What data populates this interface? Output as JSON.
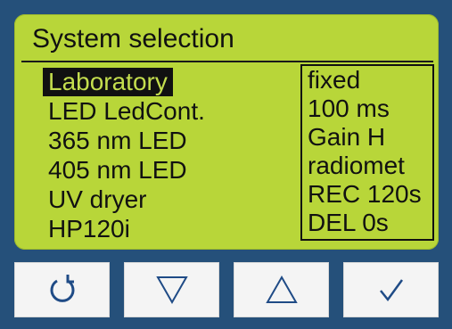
{
  "screen": {
    "title": "System selection"
  },
  "menu": {
    "items": [
      {
        "label": "Laboratory",
        "selected": true
      },
      {
        "label": "LED LedCont.",
        "selected": false
      },
      {
        "label": "365 nm LED",
        "selected": false
      },
      {
        "label": "405 nm LED",
        "selected": false
      },
      {
        "label": "UV dryer",
        "selected": false
      },
      {
        "label": "HP120i",
        "selected": false
      }
    ]
  },
  "parameters": {
    "items": [
      "fixed",
      "100 ms",
      "Gain H",
      "radiomet",
      "REC 120s",
      "DEL 0s"
    ]
  },
  "buttons": [
    {
      "name": "back-button",
      "icon": "back-arrow-icon"
    },
    {
      "name": "down-button",
      "icon": "triangle-down-icon"
    },
    {
      "name": "up-button",
      "icon": "triangle-up-icon"
    },
    {
      "name": "confirm-button",
      "icon": "checkmark-icon"
    }
  ],
  "colors": {
    "bezel": "#25507a",
    "lcd_background": "#b8d639",
    "lcd_text": "#111111",
    "button_face": "#f4f4f4",
    "button_icon": "#1f4b86"
  }
}
